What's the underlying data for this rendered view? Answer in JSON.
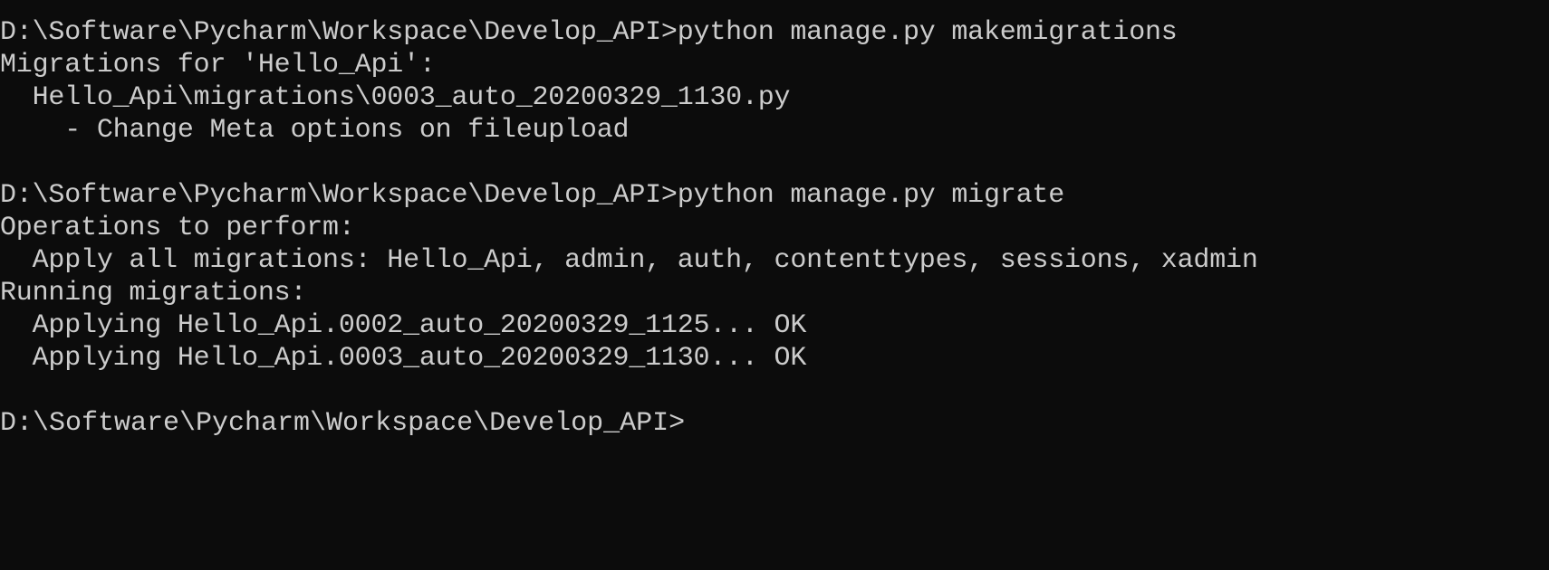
{
  "theme": {
    "background": "#0c0c0c",
    "foreground": "#cccccc"
  },
  "lines": [
    "D:\\Software\\Pycharm\\Workspace\\Develop_API>python manage.py makemigrations",
    "Migrations for 'Hello_Api':",
    "  Hello_Api\\migrations\\0003_auto_20200329_1130.py",
    "    - Change Meta options on fileupload",
    "",
    "D:\\Software\\Pycharm\\Workspace\\Develop_API>python manage.py migrate",
    "Operations to perform:",
    "  Apply all migrations: Hello_Api, admin, auth, contenttypes, sessions, xadmin",
    "Running migrations:",
    "  Applying Hello_Api.0002_auto_20200329_1125... OK",
    "  Applying Hello_Api.0003_auto_20200329_1130... OK",
    "",
    "D:\\Software\\Pycharm\\Workspace\\Develop_API>"
  ]
}
